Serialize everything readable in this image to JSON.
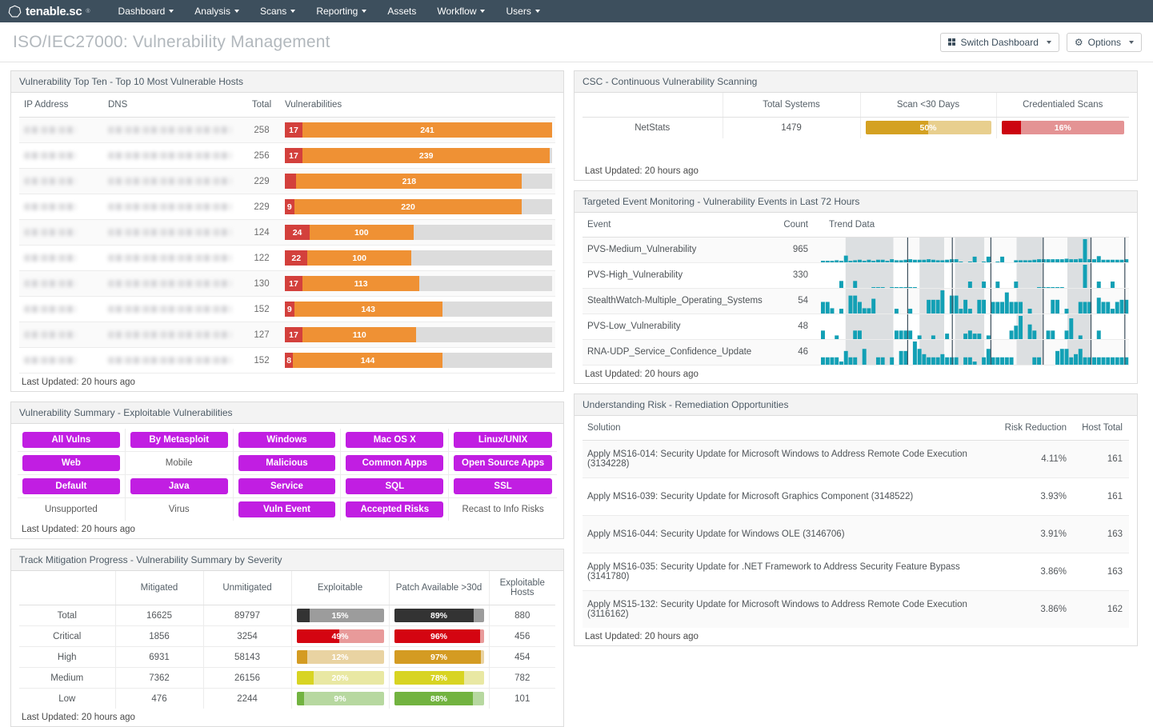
{
  "nav": {
    "brand": "tenable.sc",
    "brand_tm": "®",
    "items": [
      {
        "label": "Dashboard",
        "caret": true
      },
      {
        "label": "Analysis",
        "caret": true
      },
      {
        "label": "Scans",
        "caret": true
      },
      {
        "label": "Reporting",
        "caret": true
      },
      {
        "label": "Assets",
        "caret": false
      },
      {
        "label": "Workflow",
        "caret": true
      },
      {
        "label": "Users",
        "caret": true
      }
    ]
  },
  "header": {
    "title": "ISO/IEC27000: Vulnerability Management",
    "switch_dashboard": "Switch Dashboard",
    "options": "Options"
  },
  "colors": {
    "navbar": "#3d4f5d",
    "critical": "#d3403c",
    "high": "#ef9134",
    "medium": "#d8d423",
    "low": "#7dbf4a",
    "total_dark": "#333333",
    "purple": "#c11ee2",
    "teal": "#12a0b5",
    "track": "#dcdcdc"
  },
  "panels": {
    "top_ten": {
      "title": "Vulnerability Top Ten - Top 10 Most Vulnerable Hosts",
      "columns": [
        "IP Address",
        "DNS",
        "Total",
        "Vulnerabilities"
      ],
      "last_updated": "Last Updated: 20 hours ago",
      "max_total": 258,
      "rows": [
        {
          "ip": "",
          "dns": "",
          "total": 258,
          "critical": 17,
          "high": 241,
          "critical_label": "17",
          "high_label": "241"
        },
        {
          "ip": "",
          "dns": "",
          "total": 256,
          "critical": 17,
          "high": 239,
          "critical_label": "17",
          "high_label": "239"
        },
        {
          "ip": "",
          "dns": "",
          "total": 229,
          "critical": 11,
          "high": 218,
          "critical_label": "",
          "high_label": "218"
        },
        {
          "ip": "",
          "dns": "",
          "total": 229,
          "critical": 9,
          "high": 220,
          "critical_label": "9",
          "high_label": "220"
        },
        {
          "ip": "",
          "dns": "",
          "total": 124,
          "critical": 24,
          "high": 100,
          "critical_label": "24",
          "high_label": "100"
        },
        {
          "ip": "",
          "dns": "",
          "total": 122,
          "critical": 22,
          "high": 100,
          "critical_label": "22",
          "high_label": "100"
        },
        {
          "ip": "",
          "dns": "",
          "total": 130,
          "critical": 17,
          "high": 113,
          "critical_label": "17",
          "high_label": "113"
        },
        {
          "ip": "",
          "dns": "",
          "total": 152,
          "critical": 9,
          "high": 143,
          "critical_label": "9",
          "high_label": "143"
        },
        {
          "ip": "",
          "dns": "",
          "total": 127,
          "critical": 17,
          "high": 110,
          "critical_label": "17",
          "high_label": "110"
        },
        {
          "ip": "",
          "dns": "",
          "total": 152,
          "critical": 8,
          "high": 144,
          "critical_label": "8",
          "high_label": "144"
        }
      ]
    },
    "vuln_summary": {
      "title": "Vulnerability Summary - Exploitable Vulnerabilities",
      "last_updated": "Last Updated: 20 hours ago",
      "buttons": [
        {
          "label": "All Vulns",
          "active": true
        },
        {
          "label": "By Metasploit",
          "active": true
        },
        {
          "label": "Windows",
          "active": true
        },
        {
          "label": "Mac OS X",
          "active": true
        },
        {
          "label": "Linux/UNIX",
          "active": true
        },
        {
          "label": "Web",
          "active": true
        },
        {
          "label": "Mobile",
          "active": false
        },
        {
          "label": "Malicious",
          "active": true
        },
        {
          "label": "Common Apps",
          "active": true
        },
        {
          "label": "Open Source Apps",
          "active": true
        },
        {
          "label": "Default",
          "active": true
        },
        {
          "label": "Java",
          "active": true
        },
        {
          "label": "Service",
          "active": true
        },
        {
          "label": "SQL",
          "active": true
        },
        {
          "label": "SSL",
          "active": true
        },
        {
          "label": "Unsupported",
          "active": false
        },
        {
          "label": "Virus",
          "active": false
        },
        {
          "label": "Vuln Event",
          "active": true
        },
        {
          "label": "Accepted Risks",
          "active": true
        },
        {
          "label": "Recast to Info Risks",
          "active": false
        }
      ]
    },
    "mitigation": {
      "title": "Track Mitigation Progress - Vulnerability Summary by Severity",
      "last_updated": "Last Updated: 20 hours ago",
      "columns": [
        "",
        "Mitigated",
        "Unmitigated",
        "Exploitable",
        "Patch Available >30d",
        "Exploitable Hosts"
      ],
      "rows": [
        {
          "severity": "Total",
          "mitigated": "16625",
          "unmitigated": "89797",
          "exploitable_pct": 15,
          "exploitable_label": "15%",
          "patch_pct": 89,
          "patch_label": "89%",
          "hosts": "880",
          "fill": "#333333",
          "track": "#9c9c9c"
        },
        {
          "severity": "Critical",
          "mitigated": "1856",
          "unmitigated": "3254",
          "exploitable_pct": 49,
          "exploitable_label": "49%",
          "patch_pct": 96,
          "patch_label": "96%",
          "hosts": "456",
          "fill": "#d40511",
          "track": "#e89a9a"
        },
        {
          "severity": "High",
          "mitigated": "6931",
          "unmitigated": "58143",
          "exploitable_pct": 12,
          "exploitable_label": "12%",
          "patch_pct": 97,
          "patch_label": "97%",
          "hosts": "454",
          "fill": "#d49b22",
          "track": "#e9d3a2"
        },
        {
          "severity": "Medium",
          "mitigated": "7362",
          "unmitigated": "26156",
          "exploitable_pct": 20,
          "exploitable_label": "20%",
          "patch_pct": 78,
          "patch_label": "78%",
          "hosts": "782",
          "fill": "#d8d423",
          "track": "#e9e8a3"
        },
        {
          "severity": "Low",
          "mitigated": "476",
          "unmitigated": "2244",
          "exploitable_pct": 9,
          "exploitable_label": "9%",
          "patch_pct": 88,
          "patch_label": "88%",
          "hosts": "101",
          "fill": "#72b340",
          "track": "#b7d8a0"
        }
      ]
    },
    "csc": {
      "title": "CSC - Continuous Vulnerability Scanning",
      "last_updated": "Last Updated: 20 hours ago",
      "columns": [
        "",
        "Total Systems",
        "Scan <30 Days",
        "Credentialed Scans"
      ],
      "rows": [
        {
          "name": "NetStats",
          "total_systems": "1479",
          "scan_pct": 50,
          "scan_label": "50%",
          "scan_fill": "#d4a122",
          "scan_track": "#e8cf8e",
          "cred_pct": 16,
          "cred_label": "16%",
          "cred_fill": "#cc0510",
          "cred_track": "#e49394"
        }
      ]
    },
    "events": {
      "title": "Targeted Event Monitoring - Vulnerability Events in Last 72 Hours",
      "last_updated": "Last Updated: 20 hours ago",
      "columns": [
        "Event",
        "Count",
        "Trend Data"
      ],
      "rows": [
        {
          "event": "PVS-Medium_Vulnerability",
          "count": "965",
          "spark": [
            3,
            3,
            3,
            4,
            3,
            13,
            3,
            4,
            5,
            3,
            5,
            3,
            5,
            5,
            3,
            6,
            4,
            4,
            5,
            6,
            5,
            5,
            5,
            6,
            5,
            4,
            4,
            5,
            6,
            6,
            1,
            0,
            1,
            11,
            0,
            1,
            11,
            0,
            1,
            11,
            0,
            0,
            4,
            4,
            4,
            4,
            5,
            6,
            6,
            6,
            6,
            6,
            6,
            7,
            6,
            6,
            7,
            45,
            6,
            6,
            12,
            5,
            5,
            5,
            5,
            5,
            6
          ]
        },
        {
          "event": "PVS-High_Vulnerability",
          "count": "330",
          "spark": [
            0,
            0,
            0,
            0,
            12,
            0,
            0,
            12,
            0,
            0,
            0,
            1,
            1,
            1,
            0,
            1,
            1,
            1,
            1,
            1,
            1,
            0,
            0,
            0,
            0,
            0,
            0,
            0,
            0,
            0,
            0,
            0,
            11,
            0,
            0,
            11,
            0,
            0,
            11,
            0,
            0,
            0,
            11,
            0,
            0,
            0,
            0,
            1,
            1,
            1,
            1,
            1,
            1,
            0,
            0,
            0,
            0,
            40,
            0,
            0,
            11,
            0,
            0,
            11,
            0,
            0,
            0
          ]
        },
        {
          "event": "StealthWatch-Multiple_Operating_Systems",
          "count": "54",
          "spark": [
            22,
            22,
            10,
            0,
            9,
            0,
            34,
            34,
            22,
            10,
            10,
            28,
            0,
            0,
            0,
            0,
            9,
            0,
            0,
            9,
            0,
            0,
            0,
            26,
            26,
            26,
            44,
            0,
            34,
            34,
            9,
            26,
            9,
            0,
            26,
            26,
            0,
            22,
            22,
            22,
            40,
            22,
            22,
            22,
            0,
            9,
            0,
            0,
            0,
            0,
            26,
            26,
            0,
            9,
            0,
            0,
            22,
            22,
            22,
            0,
            30,
            22,
            22,
            9,
            22,
            26,
            26
          ]
        },
        {
          "event": "PVS-Low_Vulnerability",
          "count": "48",
          "spark": [
            14,
            0,
            0,
            6,
            0,
            0,
            0,
            14,
            14,
            0,
            0,
            0,
            0,
            0,
            0,
            0,
            14,
            14,
            14,
            14,
            0,
            6,
            0,
            0,
            6,
            0,
            0,
            9,
            0,
            0,
            0,
            9,
            14,
            9,
            9,
            0,
            6,
            0,
            0,
            0,
            0,
            14,
            22,
            38,
            0,
            24,
            14,
            0,
            0,
            14,
            14,
            0,
            0,
            14,
            34,
            0,
            6,
            0,
            0,
            0,
            14,
            0,
            0,
            0,
            0,
            0,
            0
          ]
        },
        {
          "event": "RNA-UDP_Service_Confidence_Update",
          "count": "46",
          "spark": [
            14,
            14,
            14,
            14,
            6,
            26,
            14,
            14,
            0,
            30,
            0,
            0,
            14,
            14,
            0,
            14,
            0,
            26,
            26,
            0,
            44,
            30,
            20,
            14,
            14,
            14,
            20,
            14,
            14,
            14,
            0,
            14,
            14,
            6,
            0,
            14,
            30,
            14,
            14,
            14,
            14,
            14,
            0,
            0,
            0,
            0,
            14,
            14,
            0,
            0,
            0,
            26,
            30,
            30,
            14,
            20,
            30,
            14,
            14,
            14,
            14,
            14,
            14,
            14,
            14,
            14,
            14
          ]
        }
      ],
      "bands": [
        [
          0.08,
          0.235
        ],
        [
          0.32,
          0.4
        ],
        [
          0.435,
          0.53
        ],
        [
          0.635,
          0.72
        ],
        [
          0.8,
          0.875
        ]
      ],
      "dividers": [
        0.28,
        0.425,
        0.55,
        0.72,
        0.875,
        0.985
      ]
    },
    "risk": {
      "title": "Understanding Risk - Remediation Opportunities",
      "last_updated": "Last Updated: 20 hours ago",
      "columns": [
        "Solution",
        "Risk Reduction",
        "Host Total"
      ],
      "rows": [
        {
          "solution": "Apply MS16-014: Security Update for Microsoft Windows to Address Remote Code Execution (3134228)",
          "risk_reduction": "4.11%",
          "host_total": "161"
        },
        {
          "solution": "Apply MS16-039: Security Update for Microsoft Graphics Component (3148522)",
          "risk_reduction": "3.93%",
          "host_total": "161"
        },
        {
          "solution": "Apply MS16-044: Security Update for Windows OLE (3146706)",
          "risk_reduction": "3.91%",
          "host_total": "163"
        },
        {
          "solution": "Apply MS16-035: Security Update for .NET Framework to Address Security Feature Bypass (3141780)",
          "risk_reduction": "3.86%",
          "host_total": "163"
        },
        {
          "solution": "Apply MS15-132: Security Update for Microsoft Windows to Address Remote Code Execution (3116162)",
          "risk_reduction": "3.86%",
          "host_total": "162"
        }
      ]
    }
  }
}
